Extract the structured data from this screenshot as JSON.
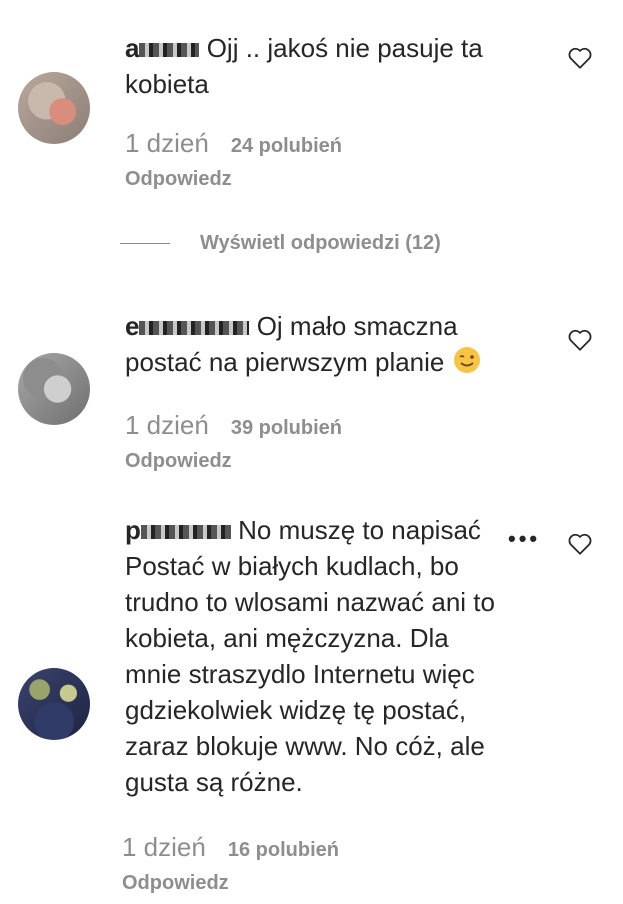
{
  "comments": [
    {
      "username_visible": "a",
      "text": "Ojj .. jakoś nie pasuje ta kobieta",
      "time": "1 dzień",
      "likes": "24 polubień",
      "reply": "Odpowiedz",
      "icon": "heart-icon"
    },
    {
      "username_visible": "e",
      "text": "Oj mało smaczna postać na pierwszym planie",
      "emoji": "winking-face-emoji",
      "time": "1 dzień",
      "likes": "39 polubień",
      "reply": "Odpowiedz",
      "icon": "heart-icon"
    },
    {
      "username_visible": "p",
      "text": "No muszę to napisać Postać w białych kudlach, bo trudno to wlosami nazwać ani to kobieta, ani mężczyzna. Dla mnie straszydlo Internetu więc gdziekolwiek widzę tę postać, zaraz blokuje www. No cóż, ale gusta są różne.",
      "time": "1 dzień",
      "likes": "16 polubień",
      "reply": "Odpowiedz",
      "icon": "heart-icon"
    }
  ],
  "view_replies": "Wyświetl odpowiedzi (12)",
  "more_icon": "more-dots-icon"
}
